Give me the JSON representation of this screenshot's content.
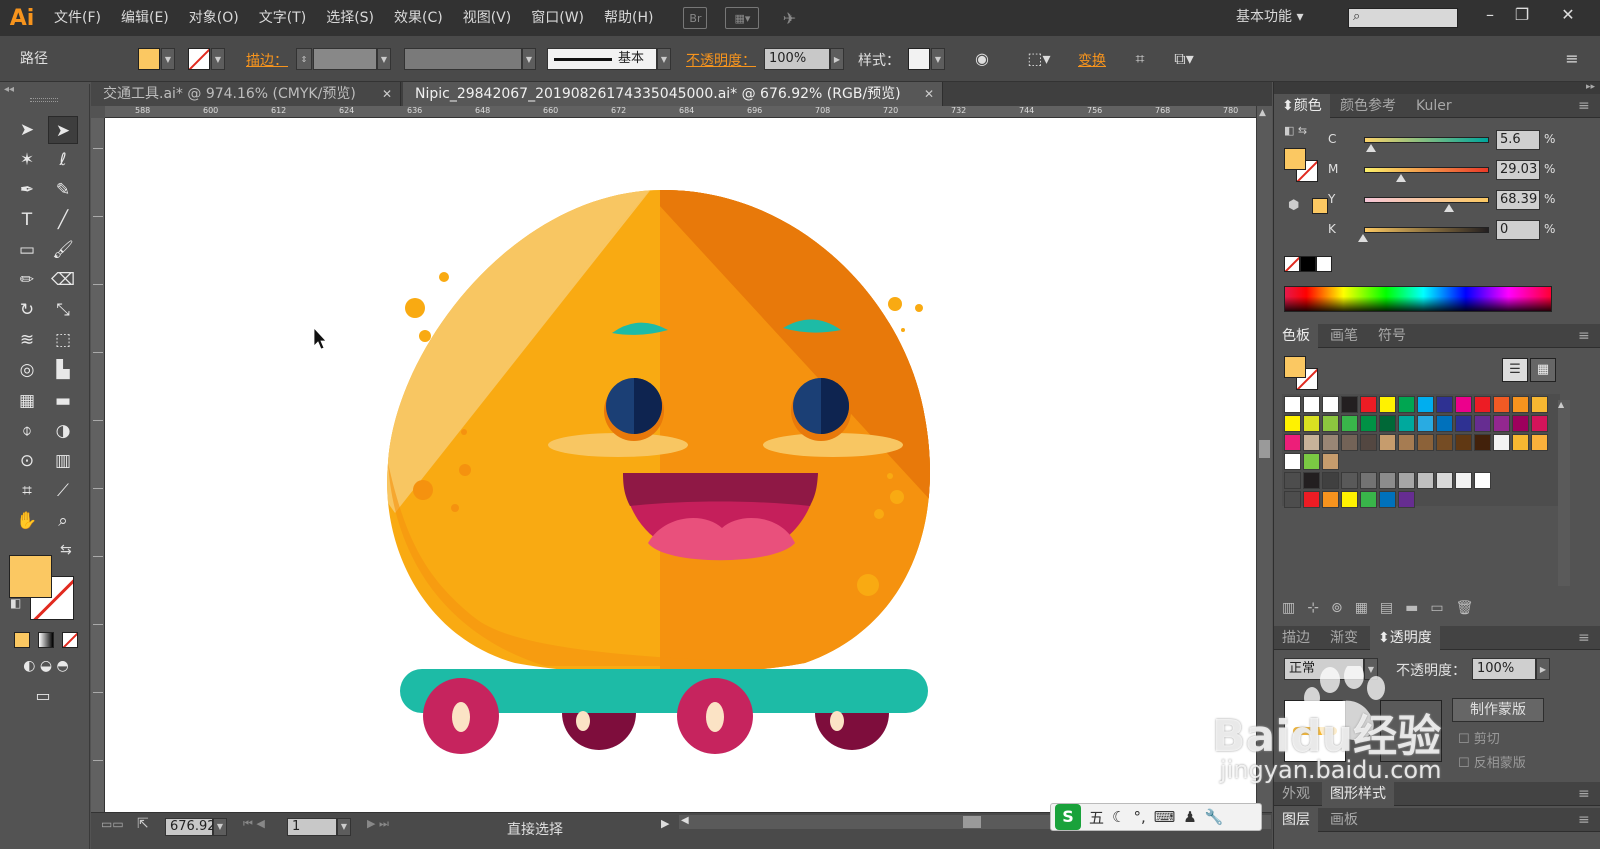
{
  "app": {
    "logo": "Ai",
    "menu": [
      "文件(F)",
      "编辑(E)",
      "对象(O)",
      "文字(T)",
      "选择(S)",
      "效果(C)",
      "视图(V)",
      "窗口(W)",
      "帮助(H)"
    ],
    "bridge_icon": "Br",
    "workspace": "基本功能",
    "search_icon": "magnifier-icon"
  },
  "control": {
    "selection_label": "路径",
    "stroke_label": "描边",
    "stroke_profile": "基本",
    "opacity_label": "不透明度",
    "opacity_value": "100%",
    "style_label": "样式",
    "transform_label": "变换",
    "fill_color": "#fbc862"
  },
  "tabs": [
    {
      "label": "交通工具.ai* @ 974.16% (CMYK/预览)",
      "active": false
    },
    {
      "label": "Nipic_29842067_20190826174335045000.ai* @ 676.92% (RGB/预览)",
      "active": true
    }
  ],
  "ruler": {
    "marks": [
      "588",
      "600",
      "612",
      "624",
      "636",
      "648",
      "660",
      "672",
      "684",
      "696",
      "708",
      "720",
      "732",
      "744",
      "756",
      "768",
      "780"
    ]
  },
  "status": {
    "zoom": "676.92",
    "page": "1",
    "tool": "直接选择"
  },
  "color_panel": {
    "tabs": [
      "颜色",
      "颜色参考",
      "Kuler"
    ],
    "channels": [
      {
        "name": "C",
        "value": "5.6"
      },
      {
        "name": "M",
        "value": "29.03"
      },
      {
        "name": "Y",
        "value": "68.39"
      },
      {
        "name": "K",
        "value": "0"
      }
    ],
    "percent": "%"
  },
  "swatches_panel": {
    "tabs": [
      "色板",
      "画笔",
      "符号"
    ]
  },
  "transparency_panel": {
    "tabs": [
      "描边",
      "渐变",
      "透明度"
    ],
    "blend_mode": "正常",
    "opacity_label": "不透明度：",
    "opacity_value": "100%",
    "make_mask": "制作蒙版",
    "clip": "剪切",
    "invert_mask": "反相蒙版"
  },
  "bottom_panels": {
    "appearance_tabs": [
      "外观",
      "图形样式"
    ],
    "layer_tabs": [
      "图层",
      "画板"
    ]
  },
  "watermark": {
    "brand": "Baidu经验",
    "url": "jingyan.baidu.com"
  },
  "ime": {
    "logo": "S",
    "mode": "五"
  },
  "colors": {
    "accent_orange": "#f7941d",
    "body_light": "#f9aa12",
    "body_mid": "#f5920f",
    "body_dark": "#e8790a",
    "highlight": "#f8c662",
    "teal": "#1dbba6",
    "wheel": "#c6245e",
    "wheel_dark": "#7e0d3c",
    "mouth": "#c51f5b",
    "tongue": "#e9507c",
    "eye": "#1b3f75"
  }
}
